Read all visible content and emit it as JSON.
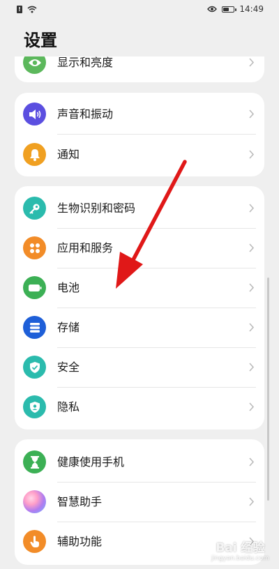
{
  "status_bar": {
    "time": "14:49"
  },
  "page": {
    "title": "设置"
  },
  "groups": [
    {
      "items": [
        {
          "label": "显示和亮度",
          "icon": "eye-icon",
          "color": "#5cb85c"
        }
      ]
    },
    {
      "items": [
        {
          "label": "声音和振动",
          "icon": "speaker-icon",
          "color": "#5b4fe0"
        },
        {
          "label": "通知",
          "icon": "bell-icon",
          "color": "#f0a021"
        }
      ]
    },
    {
      "items": [
        {
          "label": "生物识别和密码",
          "icon": "key-icon",
          "color": "#2bbbad"
        },
        {
          "label": "应用和服务",
          "icon": "apps-icon",
          "color": "#f28c28"
        },
        {
          "label": "电池",
          "icon": "battery-icon",
          "color": "#3cb055"
        },
        {
          "label": "存储",
          "icon": "storage-icon",
          "color": "#1e5fd8"
        },
        {
          "label": "安全",
          "icon": "shield-check-icon",
          "color": "#2bbbad"
        },
        {
          "label": "隐私",
          "icon": "privacy-icon",
          "color": "#2bbbad"
        }
      ]
    },
    {
      "items": [
        {
          "label": "健康使用手机",
          "icon": "hourglass-icon",
          "color": "#3cb055"
        },
        {
          "label": "智慧助手",
          "icon": "assistant-orb-icon",
          "color": "#b07cf0"
        },
        {
          "label": "辅助功能",
          "icon": "hand-icon",
          "color": "#f28c28"
        }
      ]
    }
  ],
  "watermark": {
    "main": "Bai 经验",
    "sub": "jingyan.baidu.com"
  }
}
